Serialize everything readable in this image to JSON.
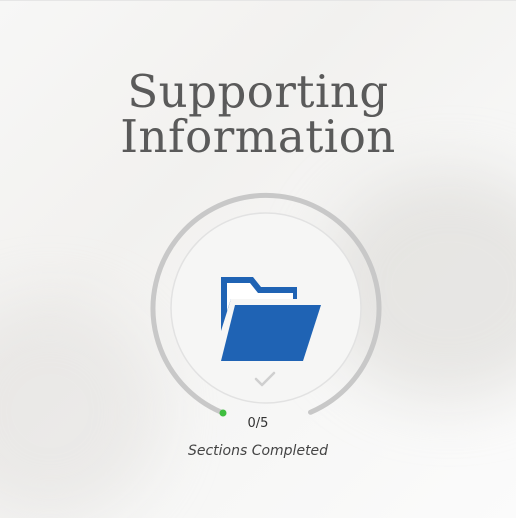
{
  "card": {
    "title_line1": "Supporting",
    "title_line2": "Information",
    "progress": {
      "completed": 0,
      "total": 5,
      "text": "0/5",
      "fraction": 0
    },
    "caption": "Sections Completed",
    "icons": {
      "main": "folder-open-icon",
      "status": "checkmark-icon"
    }
  },
  "colors": {
    "title": "#5a5a5a",
    "folder": "#1f63b4",
    "track": "#c8c8c8",
    "progress_dot": "#3fbe3f",
    "check": "#cfcfcf"
  }
}
